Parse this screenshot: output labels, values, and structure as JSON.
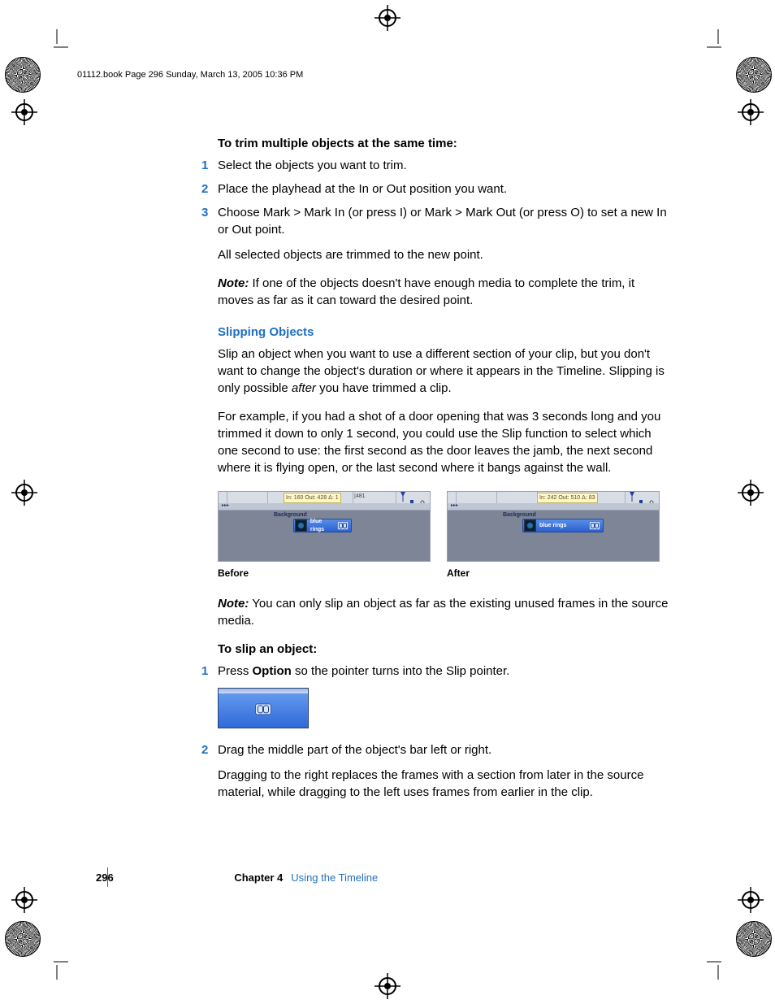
{
  "header": {
    "line": "01112.book  Page 296  Sunday, March 13, 2005  10:36 PM"
  },
  "trim": {
    "heading": "To trim multiple objects at the same time:",
    "steps": [
      "Select the objects you want to trim.",
      "Place the playhead at the In or Out position you want.",
      "Choose Mark > Mark In (or press I) or Mark > Mark Out (or press O) to set a new In or Out point."
    ],
    "result": "All selected objects are trimmed to the new point.",
    "note_label": "Note:",
    "note": "If one of the objects doesn't have enough media to complete the trim, it moves as far as it can toward the desired point."
  },
  "slipping": {
    "heading": "Slipping Objects",
    "p1_a": "Slip an object when you want to use a different section of your clip, but you don't want to change the object's duration or where it appears in the Timeline. Slipping is only possible ",
    "p1_i": "after",
    "p1_b": " you have trimmed a clip.",
    "p2": "For example, if you had a shot of a door opening that was 3 seconds long and you trimmed it down to only 1 second, you could use the Slip function to select which one second to use:   the first second as the door leaves the jamb, the next second where it is flying open, or the last second where it bangs against the wall.",
    "before_label": "Before",
    "after_label": "After",
    "before_tip": "In: 160 Out: 428 Δ: 1",
    "after_tip": "In: 242 Out: 510 Δ: 83",
    "clip_name": "blue rings",
    "track_label": "Background",
    "ruler_tick": "|481",
    "note2_label": "Note:",
    "note2": "You can only slip an object as far as the existing unused frames in the source media."
  },
  "toslip": {
    "heading": "To slip an object:",
    "step1_a": "Press ",
    "step1_b": "Option",
    "step1_c": " so the pointer turns into the Slip pointer.",
    "step2": "Drag the middle part of the object's bar left or right.",
    "step2_p": "Dragging to the right replaces the frames with a section from later in the source material, while dragging to the left uses frames from earlier in the clip."
  },
  "footer": {
    "page": "296",
    "chapter": "Chapter 4",
    "title": "Using the Timeline"
  }
}
